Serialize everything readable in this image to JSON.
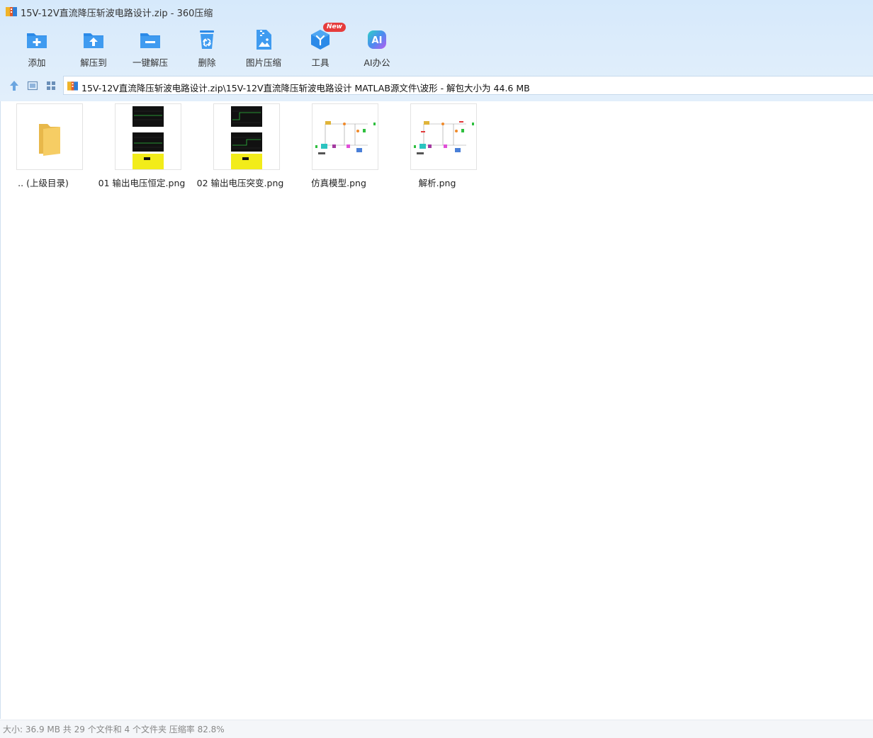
{
  "window": {
    "title": "15V-12V直流降压斩波电路设计.zip - 360压缩"
  },
  "toolbar": {
    "add": "添加",
    "extract_to": "解压到",
    "one_click_extract": "一键解压",
    "delete": "删除",
    "image_compress": "图片压缩",
    "tools": "工具",
    "tools_badge": "New",
    "ai_office": "AI办公",
    "ai_icon_text": "AI"
  },
  "address": {
    "path": "15V-12V直流降压斩波电路设计.zip\\15V-12V直流降压斩波电路设计 MATLAB源文件\\波形 - 解包大小为 44.6 MB"
  },
  "files": [
    {
      "name": ".. (上级目录)",
      "icon": "folder-icon"
    },
    {
      "name": "01 输出电压恒定.png",
      "icon": "waveform-thumbnail"
    },
    {
      "name": "02 输出电压突变.png",
      "icon": "waveform-thumbnail"
    },
    {
      "name": "仿真模型.png",
      "icon": "circuit-thumbnail"
    },
    {
      "name": "解析.png",
      "icon": "circuit-thumbnail"
    }
  ],
  "status": {
    "text": "大小: 36.9 MB 共 29 个文件和 4 个文件夹 压缩率 82.8%"
  },
  "colors": {
    "accent": "#2b8ae8",
    "badge": "#e63c3c",
    "top_bg": "#dcecfb"
  }
}
